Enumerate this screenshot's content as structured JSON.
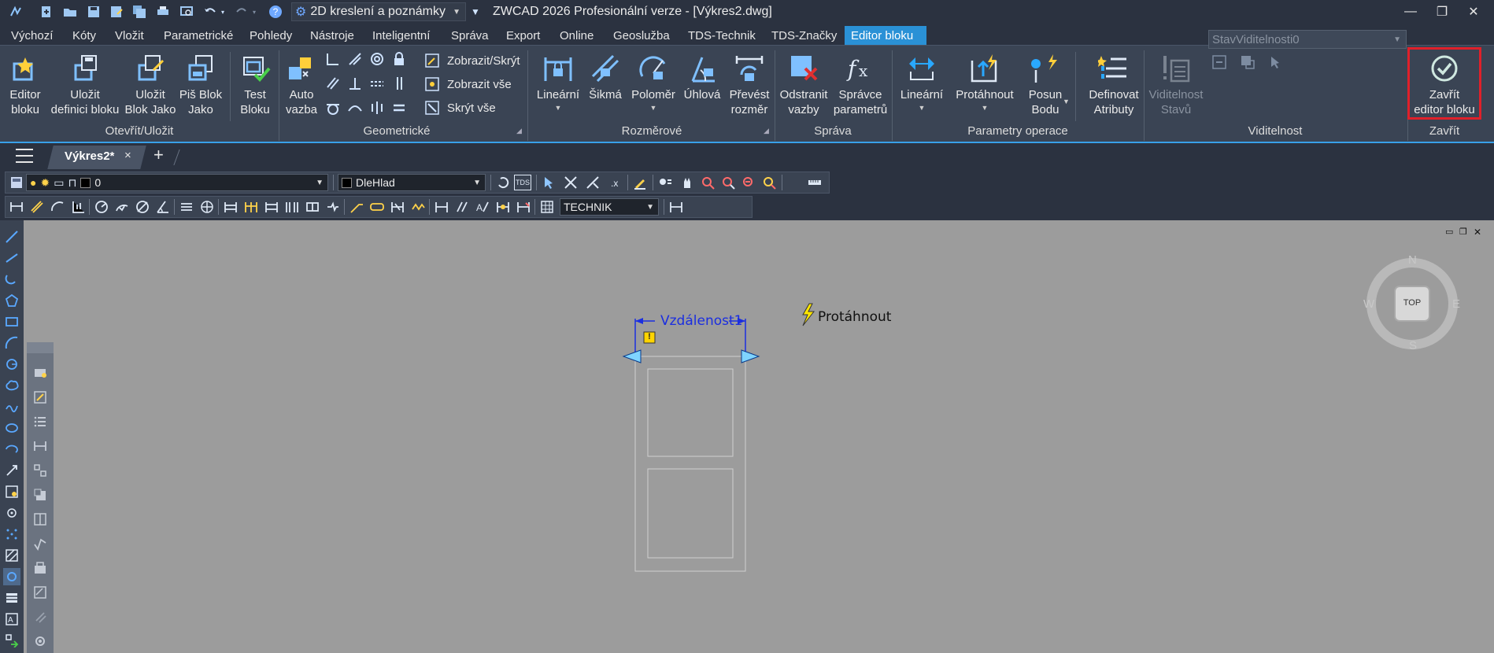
{
  "title_bar": {
    "workspace": "2D kreslení a poznámky",
    "app_title": "ZWCAD 2026 Profesionální verze - [Výkres2.dwg]"
  },
  "menu": {
    "tabs": [
      "Výchozí",
      "Kóty",
      "Vložit",
      "Parametrické",
      "Pohledy",
      "Nástroje",
      "Inteligentní",
      "Správa",
      "Export",
      "Online",
      "Geoslužba",
      "TDS-Technik",
      "TDS-Značky",
      "Editor bloku"
    ]
  },
  "ribbon": {
    "groups": {
      "open_save": {
        "label": "Otevřít/Uložit",
        "editor": [
          "Editor",
          "bloku"
        ],
        "save_def": [
          "Uložit",
          "definici bloku"
        ],
        "save_as": [
          "Uložit",
          "Blok Jako"
        ],
        "write_block": [
          "Piš Blok",
          "Jako"
        ],
        "test": [
          "Test",
          "Bloku"
        ]
      },
      "geometric": {
        "label": "Geometrické",
        "auto": [
          "Auto",
          "vazba"
        ],
        "show_hide": "Zobrazit/Skrýt",
        "show_all": "Zobrazit vše",
        "hide_all": "Skrýt vše"
      },
      "dimensional": {
        "label": "Rozměrové",
        "linear": "Lineární",
        "aligned": "Šikmá",
        "radius": "Poloměr",
        "angular": "Úhlová",
        "convert": [
          "Převést",
          "rozměr"
        ]
      },
      "manage": {
        "label": "Správa",
        "remove": [
          "Odstranit",
          "vazby"
        ],
        "params": [
          "Správce",
          "parametrů"
        ]
      },
      "operation_params": {
        "label": "Parametry operace",
        "linear": "Lineární",
        "stretch": "Protáhnout",
        "move": [
          "Posun",
          "Bodu"
        ],
        "define": [
          "Definovat",
          "Atributy"
        ]
      },
      "visibility": {
        "label": "Viditelnost",
        "states": [
          "Viditelnost",
          "Stavů"
        ],
        "current_state": "StavViditelnosti0"
      },
      "close": {
        "label": "Zavřít",
        "close_editor": [
          "Zavřít",
          "editor bloku"
        ]
      }
    }
  },
  "file_tabs": {
    "active": "Výkres2*",
    "close_glyph": "×",
    "new_glyph": "+"
  },
  "toolbar": {
    "layer": "0",
    "color": "DleHlad",
    "dimstyle": "TECHNIK",
    "rbcs_label": "TDS"
  },
  "drawing": {
    "parameter_label": "Vzdálenost1",
    "action_label": "Protáhnout",
    "alert_glyph": "!"
  },
  "viewcube": {
    "top": "TOP",
    "n": "N",
    "s": "S",
    "e": "E",
    "w": "W"
  },
  "colors": {
    "ribbon_bg": "#3a4454",
    "titlebar_bg": "#2b3240",
    "active_tab": "#2a91d6",
    "canvas": "#9c9c9c",
    "highlight": "#e0202a",
    "param_blue": "#1b2ee0"
  }
}
